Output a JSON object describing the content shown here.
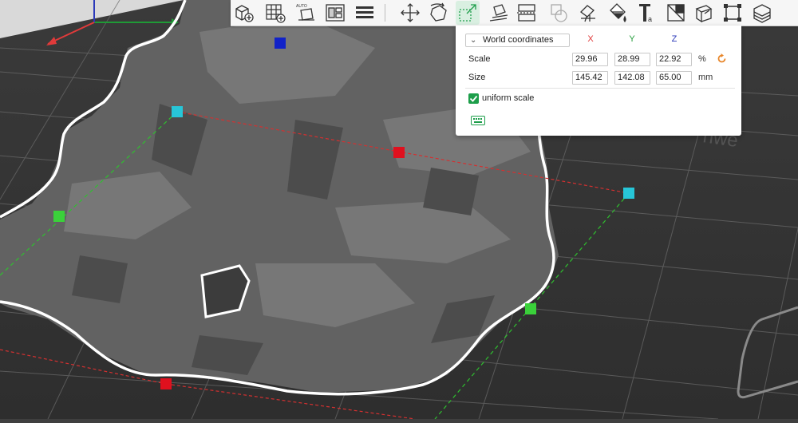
{
  "toolbar": {
    "tools": [
      {
        "name": "add-object-tool-icon"
      },
      {
        "name": "add-plate-tool-icon"
      },
      {
        "name": "auto-orient-tool-icon"
      },
      {
        "name": "arrange-tool-icon"
      },
      {
        "name": "split-layers-tool-icon"
      },
      {
        "name": "move-tool-icon"
      },
      {
        "name": "rotate-tool-icon"
      },
      {
        "name": "scale-tool-icon",
        "active": true
      },
      {
        "name": "lay-on-face-tool-icon"
      },
      {
        "name": "cut-tool-icon"
      },
      {
        "name": "mesh-boolean-tool-icon"
      },
      {
        "name": "support-paint-tool-icon"
      },
      {
        "name": "color-paint-tool-icon"
      },
      {
        "name": "text-tool-icon"
      },
      {
        "name": "seam-paint-tool-icon"
      },
      {
        "name": "measure-tool-icon"
      },
      {
        "name": "assembly-tool-icon"
      },
      {
        "name": "variable-layer-tool-icon"
      }
    ],
    "auto_badge": "AUTO"
  },
  "panel": {
    "coord_system": "World coordinates",
    "axes": [
      "X",
      "Y",
      "Z"
    ],
    "scale_label": "Scale",
    "size_label": "Size",
    "scale": {
      "x": "29.96",
      "y": "28.99",
      "z": "22.92"
    },
    "size": {
      "x": "145.42",
      "y": "142.08",
      "z": "65.00"
    },
    "scale_unit": "%",
    "size_unit": "mm",
    "uniform_scale_label": "uniform scale",
    "uniform_scale_checked": true
  },
  "bed_text": "nwe",
  "colors": {
    "accent": "#1d9e4a",
    "axis_x": "#e03a3a",
    "axis_y": "#1f9a36",
    "axis_z": "#2b39b9",
    "reset": "#e8862a",
    "handle_cyan": "#27c6d8",
    "handle_green": "#3ad13a",
    "handle_red": "#e0101e",
    "handle_blue": "#1122c8"
  }
}
